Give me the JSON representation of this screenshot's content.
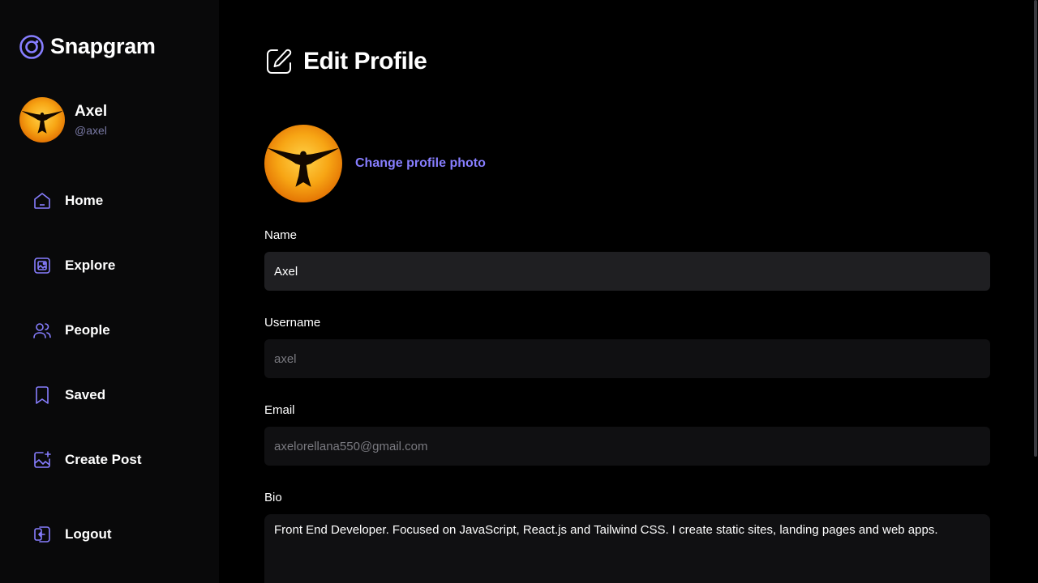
{
  "app": {
    "name": "Snapgram",
    "accent": "#877eff"
  },
  "user": {
    "name": "Axel",
    "handle": "@axel"
  },
  "nav": {
    "items": [
      {
        "label": "Home",
        "icon": "home-icon"
      },
      {
        "label": "Explore",
        "icon": "gallery-icon"
      },
      {
        "label": "People",
        "icon": "people-icon"
      },
      {
        "label": "Saved",
        "icon": "bookmark-icon"
      },
      {
        "label": "Create Post",
        "icon": "add-image-icon"
      }
    ],
    "logout": {
      "label": "Logout",
      "icon": "logout-icon"
    }
  },
  "page": {
    "title": "Edit Profile",
    "title_icon": "edit-icon",
    "change_photo": "Change profile photo"
  },
  "form": {
    "name": {
      "label": "Name",
      "value": "Axel"
    },
    "username": {
      "label": "Username",
      "value": "axel"
    },
    "email": {
      "label": "Email",
      "value": "axelorellana550@gmail.com"
    },
    "bio": {
      "label": "Bio",
      "value": "Front End Developer. Focused on JavaScript, React.js and Tailwind CSS. I create static sites, landing pages and web apps."
    }
  }
}
